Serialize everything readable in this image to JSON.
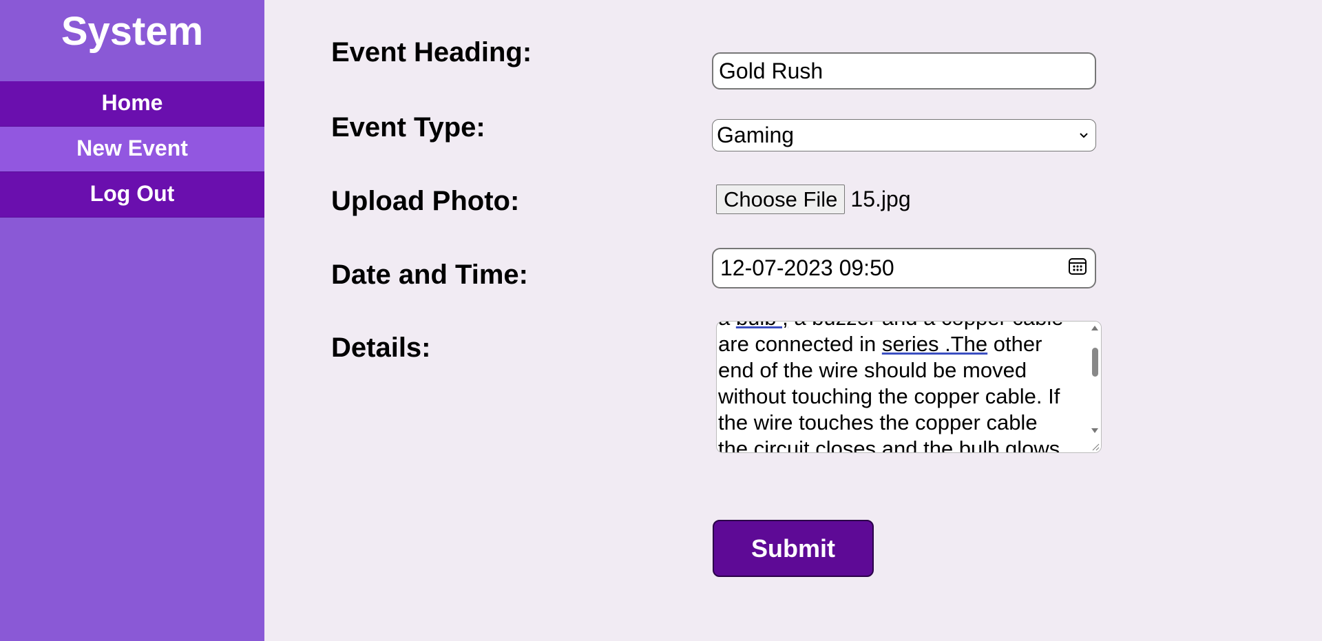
{
  "sidebar": {
    "brand": "System",
    "items": [
      {
        "label": "Home",
        "active": false
      },
      {
        "label": "New Event",
        "active": true
      },
      {
        "label": "Log Out",
        "active": false
      }
    ]
  },
  "form": {
    "heading_label": "Event Heading:",
    "heading_value": "Gold Rush",
    "type_label": "Event Type:",
    "type_value": "Gaming",
    "photo_label": "Upload Photo:",
    "photo_button": "Choose File",
    "photo_filename": "15.jpg",
    "date_label": "Date and Time:",
    "date_value": "12-07-2023 09:50",
    "details_label": "Details:",
    "details_lines": [
      {
        "pre": "a ",
        "u": "bulb ,",
        "post": " a buzzer and a copper cable"
      },
      {
        "pre": "are connected in ",
        "u": "series .The",
        "post": " other"
      },
      {
        "pre": "end of the wire should be moved",
        "u": "",
        "post": ""
      },
      {
        "pre": "without touching the copper cable. If",
        "u": "",
        "post": ""
      },
      {
        "pre": "the wire touches the copper cable",
        "u": "",
        "post": ""
      },
      {
        "pre": "the circuit closes and the bulb glows",
        "u": "",
        "post": ""
      }
    ],
    "submit_label": "Submit"
  },
  "icons": {
    "calendar": "calendar-icon",
    "dropdown": "chevron-down-icon",
    "resize": "resize-handle-icon"
  }
}
